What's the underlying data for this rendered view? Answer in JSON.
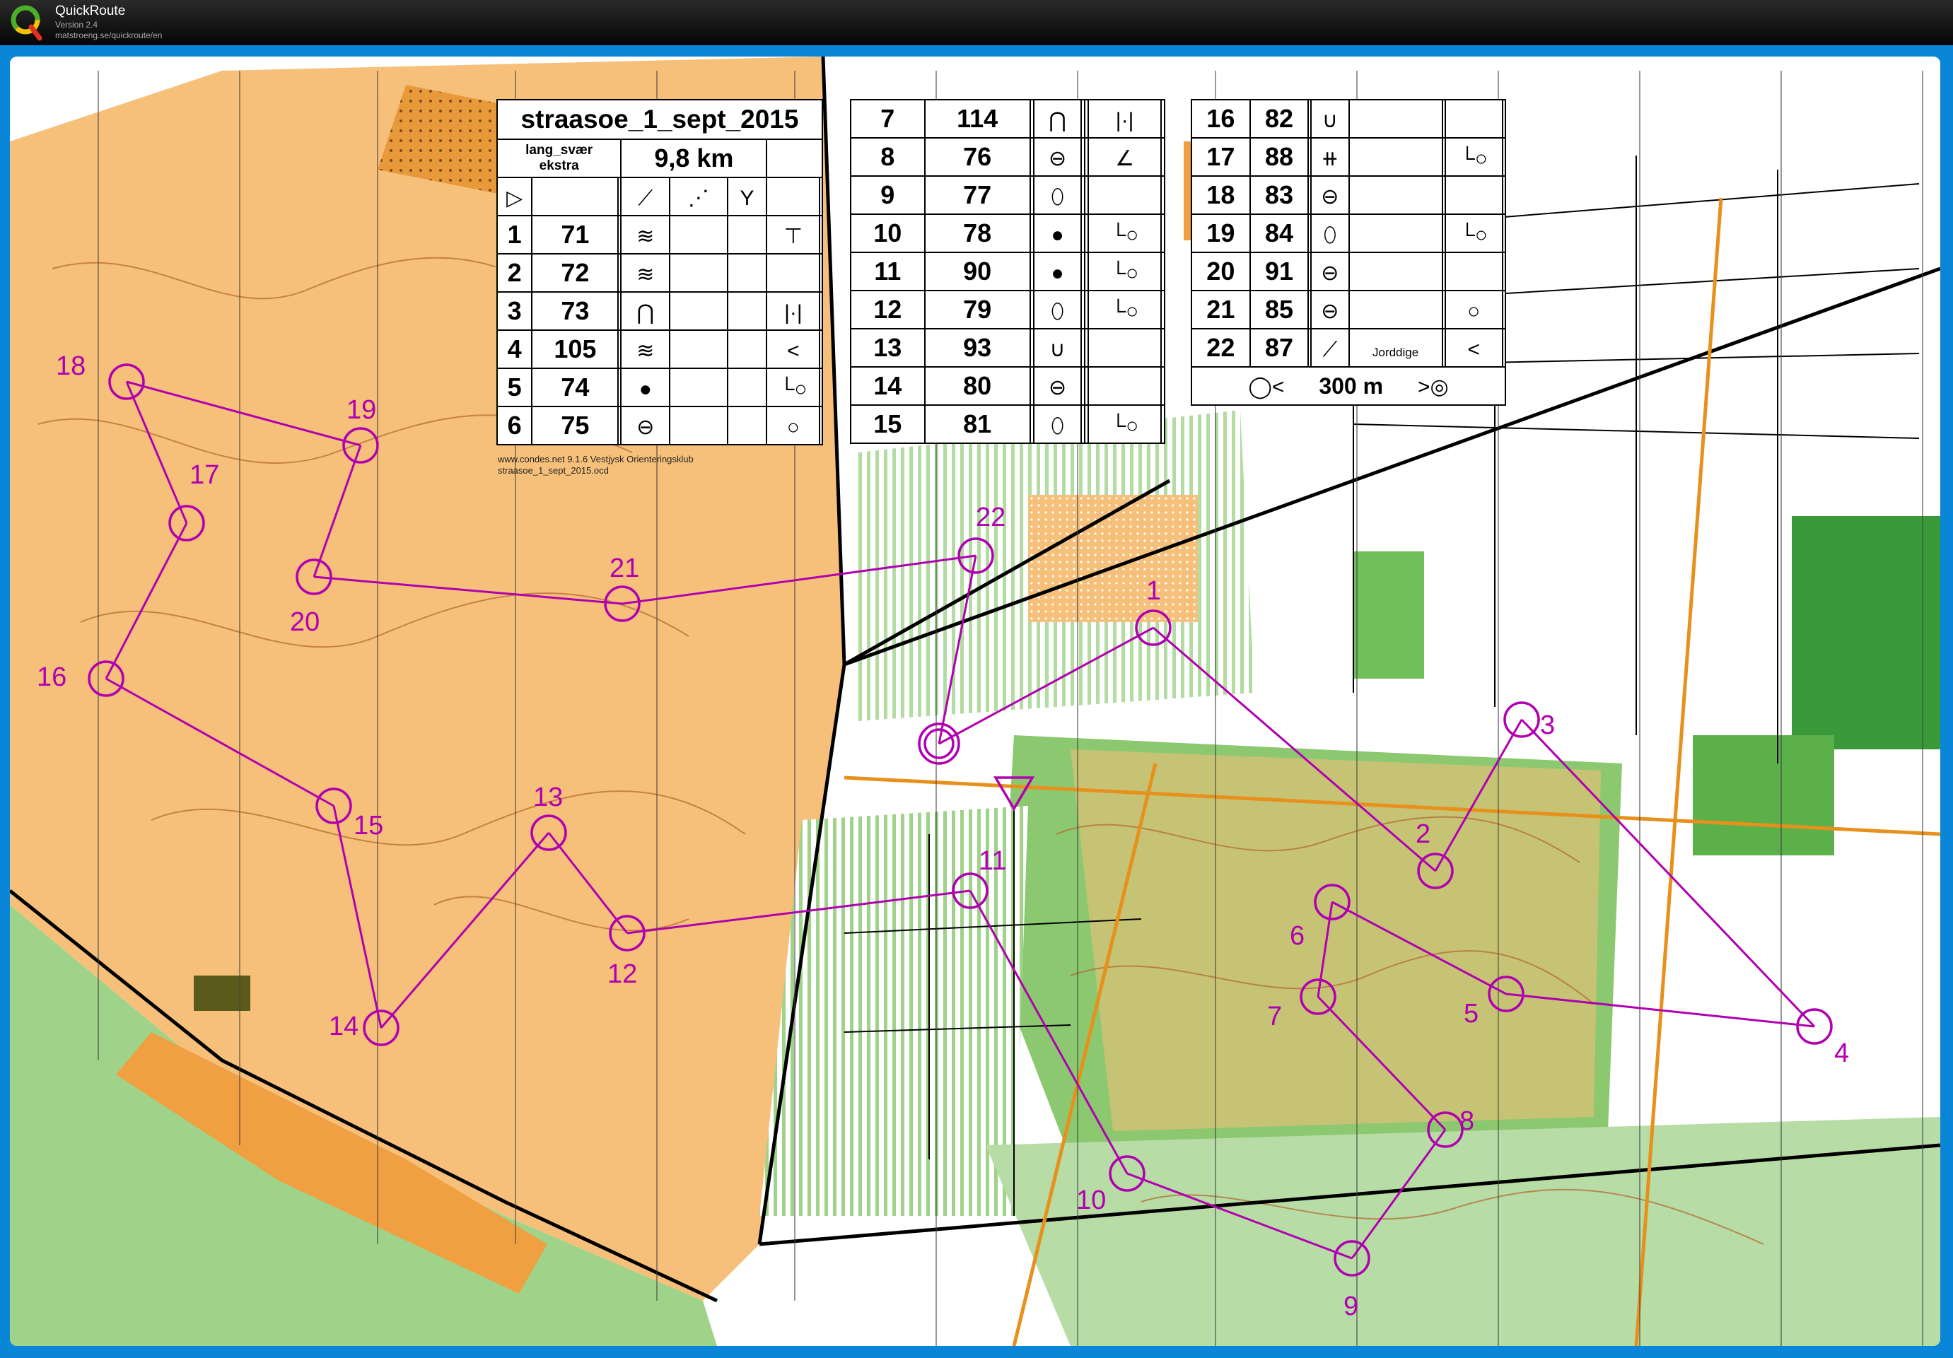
{
  "app": {
    "name": "QuickRoute",
    "version": "Version 2.4",
    "url": "matstroeng.se/quickroute/en"
  },
  "course": {
    "name": "straasoe_1_sept_2015",
    "class_line1": "lang_svær",
    "class_line2": "ekstra",
    "length": "9,8 km",
    "credit_line1": "www.condes.net 9.1.6 Vestjysk Orienteringsklub",
    "credit_line2": "straasoe_1_sept_2015.ocd",
    "finish_distance": "300 m",
    "feature_note": "Jorddige"
  },
  "controls": [
    {
      "num": "1",
      "code": "71",
      "feature": "rootstock-zigzag-icon",
      "where": "T-icon"
    },
    {
      "num": "2",
      "code": "72",
      "feature": "rootstock-v-icon",
      "where": ""
    },
    {
      "num": "3",
      "code": "73",
      "feature": "hill-icon",
      "where": "side-mark-icon"
    },
    {
      "num": "4",
      "code": "105",
      "feature": "rootstock-zigzag-icon",
      "where": "bend-icon"
    },
    {
      "num": "5",
      "code": "74",
      "feature": "thicket-dot-icon",
      "where": "foot-icon"
    },
    {
      "num": "6",
      "code": "75",
      "feature": "depression-small-icon",
      "where": "circle-side-icon"
    },
    {
      "num": "7",
      "code": "114",
      "feature": "hill-icon",
      "where": "side-mark-icon"
    },
    {
      "num": "8",
      "code": "76",
      "feature": "depression-small-icon",
      "where": "corner-icon"
    },
    {
      "num": "9",
      "code": "77",
      "feature": "oval-icon",
      "where": ""
    },
    {
      "num": "10",
      "code": "78",
      "feature": "dot-icon",
      "where": "foot-icon"
    },
    {
      "num": "11",
      "code": "90",
      "feature": "dot-icon",
      "where": "foot-icon"
    },
    {
      "num": "12",
      "code": "79",
      "feature": "oval-icon",
      "where": "foot-icon"
    },
    {
      "num": "13",
      "code": "93",
      "feature": "pit-icon",
      "where": ""
    },
    {
      "num": "14",
      "code": "80",
      "feature": "depression-small-icon",
      "where": ""
    },
    {
      "num": "15",
      "code": "81",
      "feature": "oval-icon",
      "where": "foot-icon"
    },
    {
      "num": "16",
      "code": "82",
      "feature": "pit-icon",
      "where": ""
    },
    {
      "num": "17",
      "code": "88",
      "feature": "fence-icon",
      "where": "foot-icon"
    },
    {
      "num": "18",
      "code": "83",
      "feature": "depression-small-icon",
      "where": ""
    },
    {
      "num": "19",
      "code": "84",
      "feature": "oval-icon",
      "where": "foot-icon"
    },
    {
      "num": "20",
      "code": "91",
      "feature": "depression-small-icon",
      "where": ""
    },
    {
      "num": "21",
      "code": "85",
      "feature": "depression-small-icon",
      "where": "circle-side-icon"
    },
    {
      "num": "22",
      "code": "87",
      "feature": "earth-wall-icon",
      "where": "bend-icon"
    }
  ],
  "map_labels": [
    "1",
    "2",
    "3",
    "4",
    "5",
    "6",
    "7",
    "8",
    "9",
    "10",
    "11",
    "12",
    "13",
    "14",
    "15",
    "16",
    "17",
    "18",
    "19",
    "20",
    "21",
    "22"
  ],
  "colors": {
    "course": "#b000b0",
    "forest_open": "#f6c07a",
    "open_dark": "#f0a040",
    "green": "#8cc870",
    "green_dark": "#3a9a3a",
    "contour": "#a0522d",
    "frame": "#0a86d8"
  }
}
